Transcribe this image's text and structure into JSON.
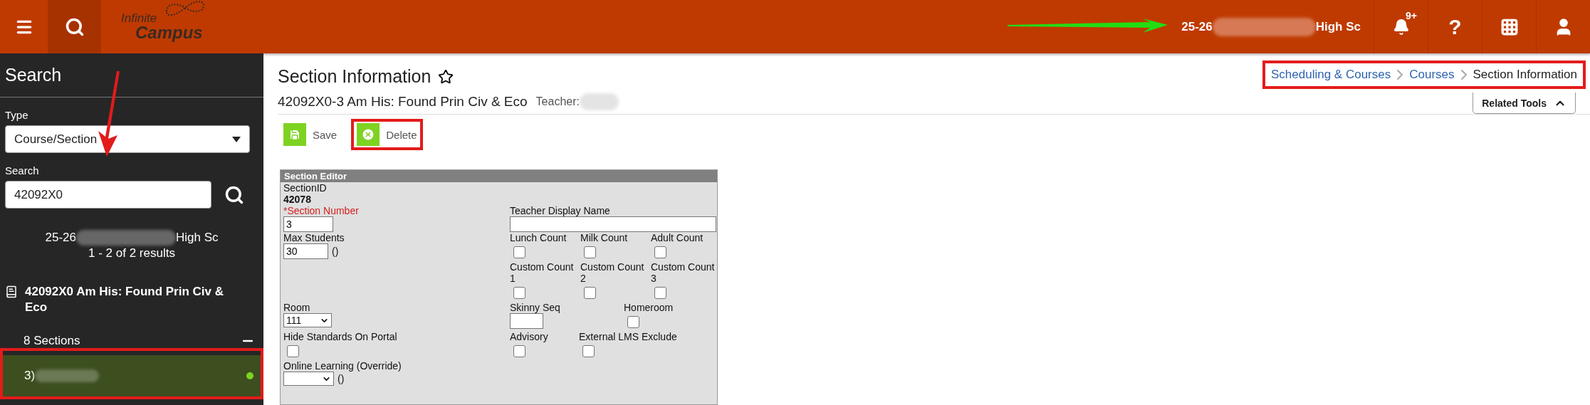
{
  "topbar": {
    "logo": {
      "line1": "Infinite",
      "line2": "Campus"
    },
    "school": {
      "prefix": "25-26",
      "suffix": "High Sc"
    },
    "notification_badge": "9+",
    "help": "?"
  },
  "sidebar": {
    "title": "Search",
    "type_label": "Type",
    "type_value": "Course/Section",
    "search_label": "Search",
    "search_value": "42092X0",
    "school": {
      "prefix": "25-26",
      "suffix": "High Sc"
    },
    "results": "1 - 2 of 2 results",
    "course": "42092X0 Am His: Found Prin Civ & Eco",
    "sections_label": "8 Sections",
    "expanded": true,
    "sections": [
      {
        "label": "3)",
        "selected": true
      }
    ]
  },
  "main": {
    "title": "Section Information",
    "favorite": false,
    "subtitle": "42092X0-3 Am His: Found Prin Civ & Eco",
    "teacher_label": "Teacher:",
    "breadcrumbs": [
      {
        "label": "Scheduling & Courses",
        "current": false
      },
      {
        "label": "Courses",
        "current": false
      },
      {
        "label": "Section Information",
        "current": true
      }
    ],
    "related_tools": {
      "label": "Related Tools",
      "expanded": true
    },
    "actions": [
      {
        "kind": "save",
        "label": "Save"
      },
      {
        "kind": "delete",
        "label": "Delete"
      }
    ]
  },
  "editor": {
    "title": "Section Editor",
    "section_id_label": "SectionID",
    "section_id": "42078",
    "section_number": {
      "label": "*Section Number",
      "value": "3",
      "required": true
    },
    "teacher_display_name": {
      "label": "Teacher Display Name"
    },
    "max_students": {
      "label": "Max Students",
      "value": "30",
      "note": "()"
    },
    "counts": [
      {
        "label": "Lunch Count",
        "checked": false
      },
      {
        "label": "Milk Count",
        "checked": false
      },
      {
        "label": "Adult Count",
        "checked": false
      }
    ],
    "custom_counts": [
      {
        "label": "Custom Count 1",
        "checked": false
      },
      {
        "label": "Custom Count 2",
        "checked": false
      },
      {
        "label": "Custom Count 3",
        "checked": false
      }
    ],
    "room": {
      "label": "Room",
      "value": "111"
    },
    "skinny_seq": {
      "label": "Skinny Seq"
    },
    "homeroom": {
      "label": "Homeroom",
      "checked": false
    },
    "hide_standards": {
      "label": "Hide Standards On Portal",
      "checked": false
    },
    "advisory": {
      "label": "Advisory",
      "checked": false
    },
    "external_lms": {
      "label": "External LMS Exclude",
      "checked": false
    },
    "online_learning": {
      "label": "Online Learning (Override)",
      "note": "()"
    }
  }
}
